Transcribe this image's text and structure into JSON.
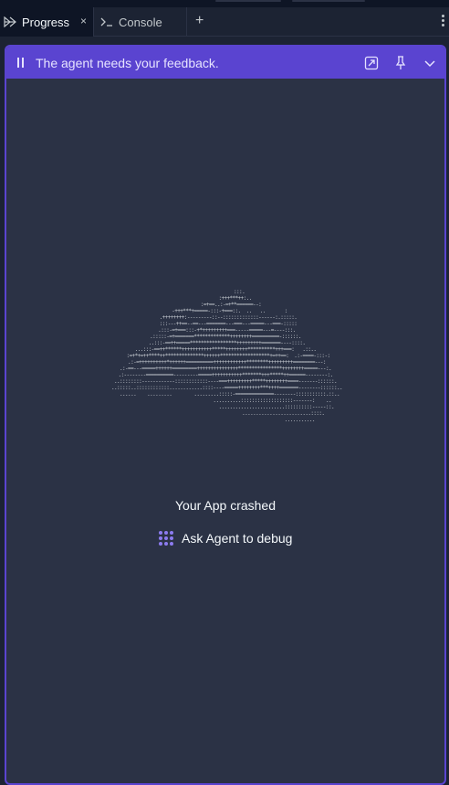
{
  "tabs": {
    "progress": {
      "label": "Progress",
      "icon": "progress-icon"
    },
    "console": {
      "label": "Console",
      "icon": "console-icon"
    },
    "close_glyph": "×",
    "add_glyph": "+"
  },
  "banner": {
    "message": "The agent needs your feedback.",
    "icons": [
      "pause-icon",
      "open-external-icon",
      "pin-icon",
      "chevron-down-icon"
    ]
  },
  "crash": {
    "title": "Your App crashed",
    "debug_label": "Ask Agent to debug",
    "debug_icon": "agent-icon"
  },
  "colors": {
    "accent": "#5a44d0",
    "panel_bg": "#2b3245",
    "app_bg": "#1c2333"
  }
}
